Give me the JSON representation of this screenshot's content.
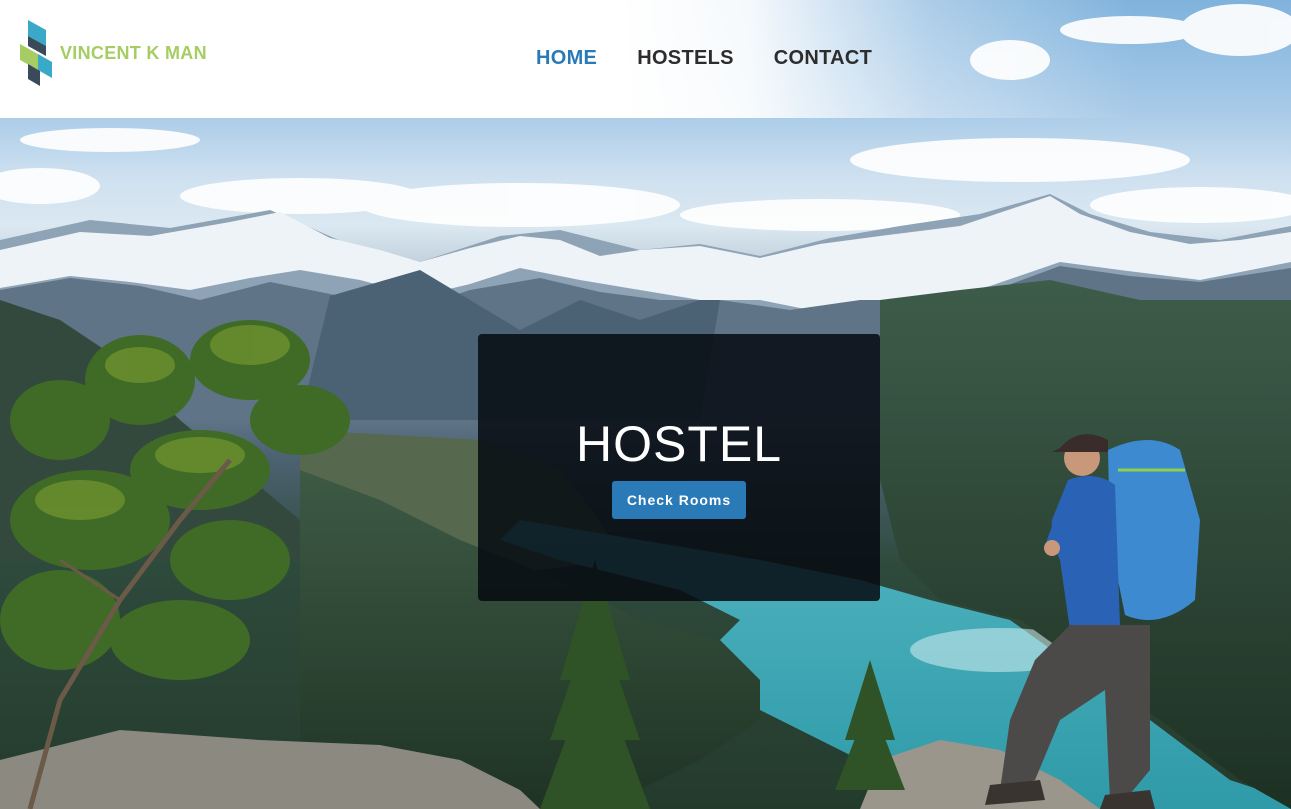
{
  "brand": {
    "name": "VINCENT K MAN",
    "logo_icon": "vk-ribbon-logo-icon",
    "colors": {
      "green": "#a6cd63",
      "blue": "#2a7ab8",
      "teal": "#3aa9c8",
      "dark": "#3b4a5a"
    }
  },
  "nav": {
    "items": [
      {
        "label": "HOME",
        "active": true
      },
      {
        "label": "HOSTELS",
        "active": false
      },
      {
        "label": "CONTACT",
        "active": false
      }
    ],
    "active_color": "#2a7ab8",
    "text_color": "#2d2d2d"
  },
  "hero": {
    "title": "HOSTEL",
    "button_label": "Check Rooms",
    "button_color": "#2a7ab8",
    "background": "mountain-lake-hiker-photo"
  }
}
